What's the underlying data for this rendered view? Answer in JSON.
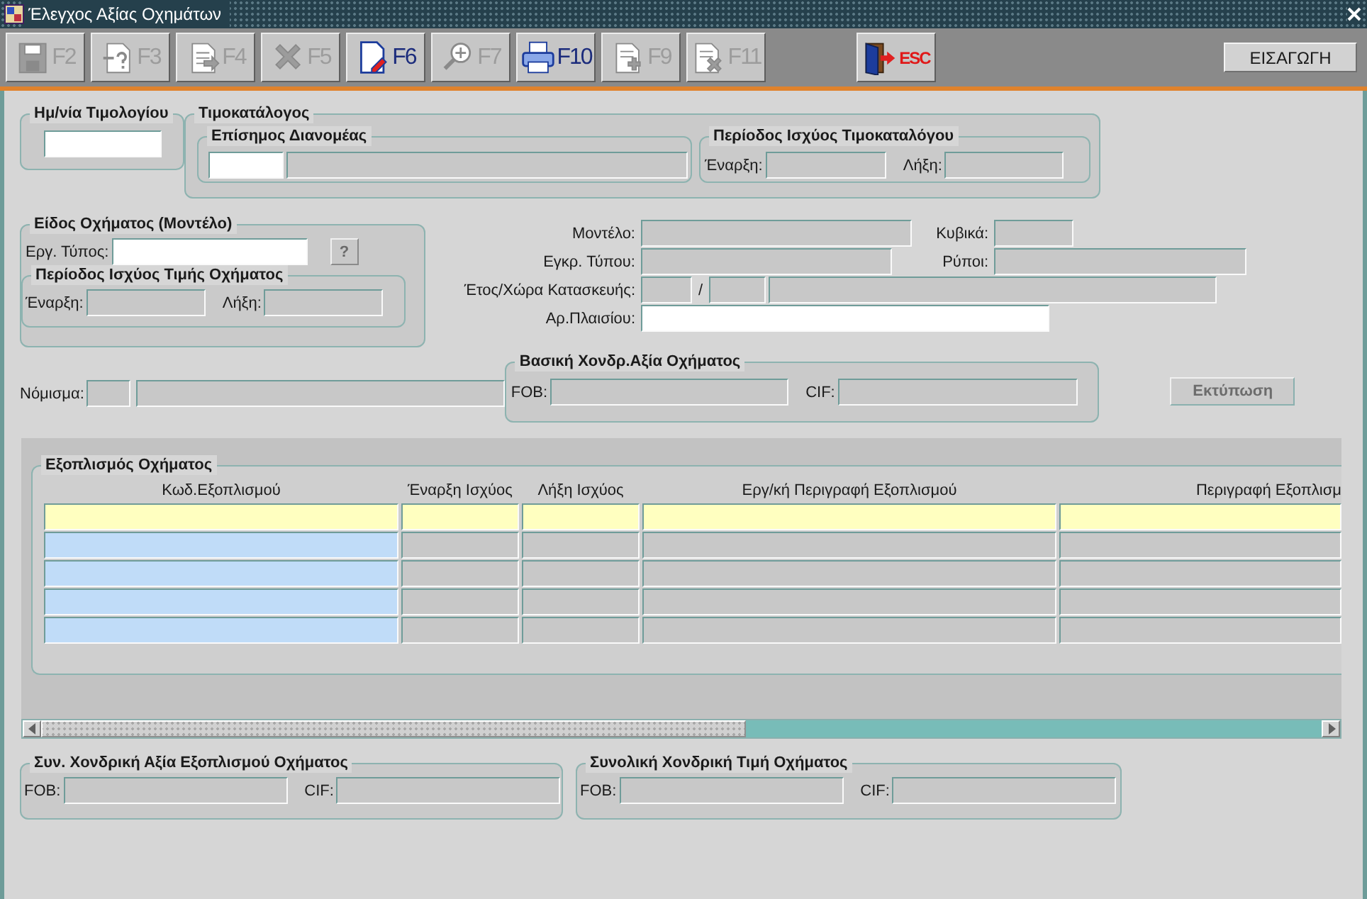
{
  "window": {
    "title": "Έλεγχος Αξίας Οχημάτων"
  },
  "toolbar": {
    "buttons": [
      {
        "kind": "save",
        "label": "F2",
        "disabled": true
      },
      {
        "kind": "query",
        "label": "F3",
        "disabled": true
      },
      {
        "kind": "execute",
        "label": "F4",
        "disabled": true
      },
      {
        "kind": "delete",
        "label": "F5",
        "disabled": true
      },
      {
        "kind": "document",
        "label": "F6",
        "disabled": false
      },
      {
        "kind": "zoom",
        "label": "F7",
        "disabled": true
      },
      {
        "kind": "print",
        "label": "F10",
        "disabled": false
      },
      {
        "kind": "insert",
        "label": "F9",
        "disabled": true
      },
      {
        "kind": "remove",
        "label": "F11",
        "disabled": true
      },
      {
        "kind": "exit",
        "label": "ESC",
        "disabled": false
      }
    ],
    "mode": "ΕΙΣΑΓΩΓΗ"
  },
  "invoice_date": {
    "title": "Ημ/νία Τιμολογίου",
    "field": {
      "editable": true
    }
  },
  "price_list": {
    "title": "Τιμοκατάλογος",
    "distributor": {
      "title": "Επίσημος Διανομέας",
      "code": {
        "editable": true
      },
      "name": {
        "editable": false
      }
    },
    "validity": {
      "title": "Περίοδος Ισχύος Τιμοκαταλόγου",
      "start_label": "Έναρξη:",
      "start": {
        "editable": false
      },
      "end_label": "Λήξη:",
      "end": {
        "editable": false
      }
    }
  },
  "vehicle_type": {
    "title": "Είδος Οχήματος (Μοντέλο)",
    "type_label": "Εργ. Τύπος:",
    "type": {
      "editable": true
    },
    "lookup_button": {
      "label": "?",
      "disabled": true
    },
    "validity": {
      "title": "Περίοδος Ισχύος Τιμής Οχήματος",
      "start_label": "Έναρξη:",
      "start": {
        "editable": false
      },
      "end_label": "Λήξη:",
      "end": {
        "editable": false
      }
    }
  },
  "details": {
    "model_label": "Μοντέλο:",
    "model": {
      "editable": false
    },
    "cc_label": "Κυβικά:",
    "cc": {
      "editable": false
    },
    "approval_label": "Εγκρ. Τύπου:",
    "approval": {
      "editable": false
    },
    "emissions_label": "Ρύποι:",
    "emissions": {
      "editable": false
    },
    "year_country_label": "Έτος/Χώρα Κατασκευής:",
    "year": {
      "editable": false
    },
    "separator": "/",
    "country_code": {
      "editable": false
    },
    "country_name": {
      "editable": false
    },
    "chassis_label": "Αρ.Πλαισίου:",
    "chassis": {
      "editable": true
    }
  },
  "currency": {
    "label": "Νόμισμα:",
    "code": {
      "editable": false
    },
    "name": {
      "editable": false
    }
  },
  "base_value": {
    "title": "Βασική Χονδρ.Αξία Οχήματος",
    "fob_label": "FOB:",
    "fob": {
      "editable": false
    },
    "cif_label": "CIF:",
    "cif": {
      "editable": false
    }
  },
  "print_button": {
    "label": "Εκτύπωση",
    "disabled": true
  },
  "equipment": {
    "title": "Εξοπλισμός Οχήματος",
    "columns": [
      {
        "label": "Κωδ.Εξοπλισμού",
        "editable": true
      },
      {
        "label": "Έναρξη Ισχύος",
        "editable": false
      },
      {
        "label": "Λήξη Ισχύος",
        "editable": false
      },
      {
        "label": "Εργ/κή Περιγραφή Εξοπλισμού",
        "editable": false
      },
      {
        "label": "Περιγραφή Εξοπλισμ",
        "editable": false
      }
    ],
    "rows": [
      {
        "selected": true
      },
      {
        "selected": false
      },
      {
        "selected": false
      },
      {
        "selected": false
      },
      {
        "selected": false
      }
    ]
  },
  "equipment_total": {
    "title": "Συν. Χονδρική Αξία Εξοπλισμού Οχήματος",
    "fob_label": "FOB:",
    "fob": {
      "editable": false
    },
    "cif_label": "CIF:",
    "cif": {
      "editable": false
    }
  },
  "vehicle_total": {
    "title": "Συνολική Χονδρική Τιμή Οχήματος",
    "fob_label": "FOB:",
    "fob": {
      "editable": false
    },
    "cif_label": "CIF:",
    "cif": {
      "editable": false
    }
  }
}
